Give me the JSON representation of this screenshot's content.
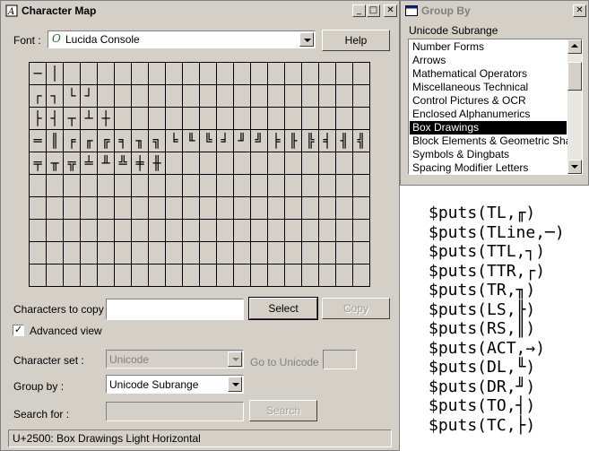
{
  "charmap": {
    "title": "Character Map",
    "font_label": "Font :",
    "font_value": "Lucida Console",
    "help_label": "Help",
    "grid_rows": [
      [
        "─",
        "│",
        "",
        "",
        "",
        "",
        "",
        "",
        "",
        "",
        "",
        "",
        "",
        "",
        "",
        "",
        "",
        "",
        "",
        ""
      ],
      [
        "┌",
        "┐",
        "└",
        "┘",
        "",
        "",
        "",
        "",
        "",
        "",
        "",
        "",
        "",
        "",
        "",
        "",
        "",
        "",
        "",
        ""
      ],
      [
        "├",
        "┤",
        "┬",
        "┴",
        "┼",
        "",
        "",
        "",
        "",
        "",
        "",
        "",
        "",
        "",
        "",
        "",
        "",
        "",
        "",
        ""
      ],
      [
        "═",
        "║",
        "╒",
        "╓",
        "╔",
        "╕",
        "╖",
        "╗",
        "╘",
        "╙",
        "╚",
        "╛",
        "╜",
        "╝",
        "╞",
        "╟",
        "╠",
        "╡",
        "╢",
        "╣"
      ],
      [
        "╤",
        "╥",
        "╦",
        "╧",
        "╨",
        "╩",
        "╪",
        "╫",
        "",
        "",
        "",
        "",
        "",
        "",
        "",
        "",
        "",
        "",
        "",
        ""
      ],
      [
        "",
        "",
        "",
        "",
        "",
        "",
        "",
        "",
        "",
        "",
        "",
        "",
        "",
        "",
        "",
        "",
        "",
        "",
        "",
        ""
      ],
      [
        "",
        "",
        "",
        "",
        "",
        "",
        "",
        "",
        "",
        "",
        "",
        "",
        "",
        "",
        "",
        "",
        "",
        "",
        "",
        ""
      ],
      [
        "",
        "",
        "",
        "",
        "",
        "",
        "",
        "",
        "",
        "",
        "",
        "",
        "",
        "",
        "",
        "",
        "",
        "",
        "",
        ""
      ],
      [
        "",
        "",
        "",
        "",
        "",
        "",
        "",
        "",
        "",
        "",
        "",
        "",
        "",
        "",
        "",
        "",
        "",
        "",
        "",
        ""
      ],
      [
        "",
        "",
        "",
        "",
        "",
        "",
        "",
        "",
        "",
        "",
        "",
        "",
        "",
        "",
        "",
        "",
        "",
        "",
        "",
        ""
      ]
    ],
    "chars_to_copy_label": "Characters to copy :",
    "chars_to_copy_value": "",
    "select_label": "Select",
    "copy_label": "Copy",
    "advanced_label": "Advanced view",
    "advanced_checked": "✓",
    "charset_label": "Character set :",
    "charset_value": "Unicode",
    "goto_label": "Go to Unicode :",
    "groupby_label": "Group by :",
    "groupby_value": "Unicode Subrange",
    "search_label": "Search for :",
    "search_button": "Search",
    "status": "U+2500: Box Drawings Light Horizontal"
  },
  "groupby": {
    "title": "Group By",
    "heading": "Unicode Subrange",
    "items": [
      "Number Forms",
      "Arrows",
      "Mathematical Operators",
      "Miscellaneous Technical",
      "Control Pictures & OCR",
      "Enclosed Alphanumerics",
      "Box Drawings",
      "Block Elements & Geometric Shapes",
      "Symbols & Dingbats",
      "Spacing Modifier Letters"
    ],
    "selected": "Box Drawings"
  },
  "code_lines": [
    "$puts(TL,╓)",
    "$puts(TLine,─)",
    "$puts(TTL,┐)",
    "$puts(TTR,┌)",
    "$puts(TR,╖)",
    "$puts(LS,╟)",
    "$puts(RS,║)",
    "$puts(ACT,→)",
    "$puts(DL,╙)",
    "$puts(DR,╜)",
    "$puts(TO,┤)",
    "$puts(TC,├)"
  ]
}
